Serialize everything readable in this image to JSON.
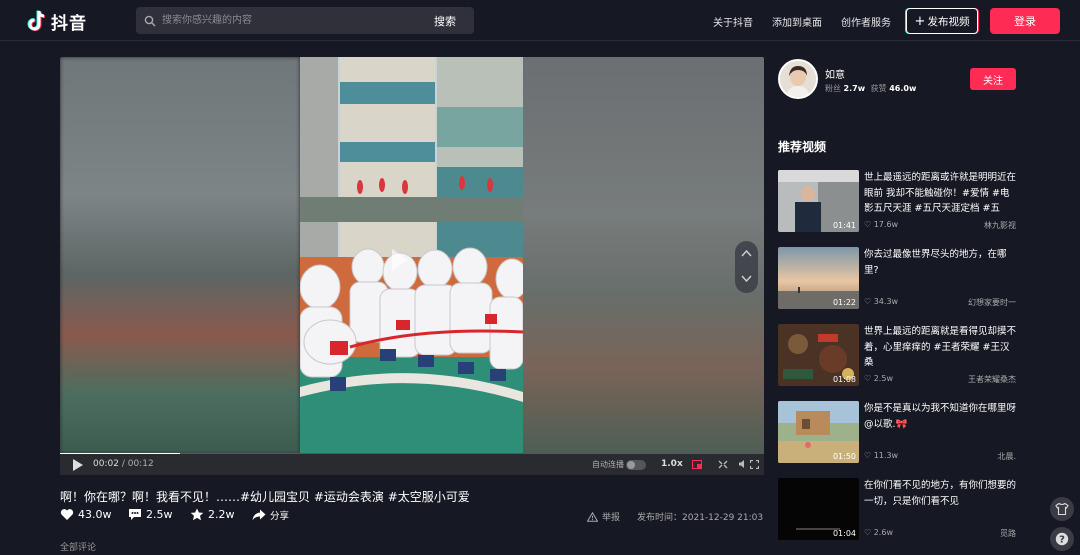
{
  "header": {
    "logo_text": "抖音",
    "search_placeholder": "搜索你感兴趣的内容",
    "search_button": "搜索",
    "nav": [
      "关于抖音",
      "添加到桌面",
      "创作者服务"
    ],
    "upload_label": "发布视频",
    "login_label": "登录"
  },
  "player": {
    "current_time": "00:02",
    "separator": "/",
    "total_time": "00:12",
    "progress": 0.17,
    "autoplay_label": "自动连播",
    "speed": "1.0x"
  },
  "video": {
    "title": "啊！你在哪？啊！我看不见！……#幼儿园宝贝 #运动会表演 #太空服小可爱",
    "likes": "43.0w",
    "comments": "2.5w",
    "favorites": "2.2w",
    "share_label": "分享",
    "report_label": "举报",
    "publish_label": "发布时间：",
    "publish_time": "2021-12-29 21:03",
    "comments_section": "全部评论"
  },
  "author": {
    "name": "如意",
    "fans_label": "粉丝",
    "fans": "2.7w",
    "likes_label": "获赞",
    "likes": "46.0w",
    "follow_label": "关注"
  },
  "recommend": {
    "title": "推荐视频",
    "items": [
      {
        "text": "世上最遥远的距离或许就是明明近在眼前 我却不能触碰你！#爱情 #电影五尺天涯 #五尺天涯定档 #五尺…",
        "duration": "01:41",
        "likes": "17.6w",
        "author": "林九影视"
      },
      {
        "text": "你去过最像世界尽头的地方，在哪里?",
        "duration": "01:22",
        "likes": "34.3w",
        "author": "幻想家要时一"
      },
      {
        "text": "世界上最远的距离就是看得见却摸不着，心里痒痒的 #王者荣耀 #王汉桑",
        "duration": "01:08",
        "likes": "2.5w",
        "author": "王者荣耀桑杰"
      },
      {
        "text": "你是不是真以为我不知道你在哪里呀@以歌.🎀",
        "duration": "01:50",
        "likes": "11.3w",
        "author": "北晨."
      },
      {
        "text": "在你们看不见的地方，有你们想要的一切，只是你们看不见",
        "duration": "01:04",
        "likes": "2.6w",
        "author": "觅路"
      }
    ]
  }
}
